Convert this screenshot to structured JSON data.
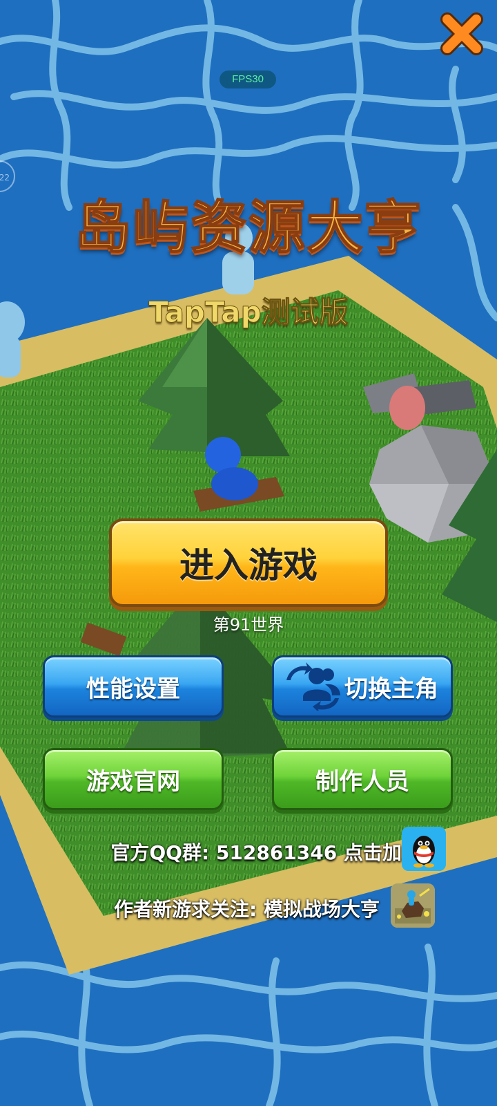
{
  "hud": {
    "fps_label": "FPS30",
    "side_dial_text": "22"
  },
  "header": {
    "title": "岛屿资源大亨",
    "subtitle": "TapTap测试版"
  },
  "main": {
    "enter_button": "进入游戏",
    "world_label": "第91世界",
    "settings_button": "性能设置",
    "switch_character_button": "切换主角",
    "official_site_button": "游戏官网",
    "credits_button": "制作人员"
  },
  "footer": {
    "qq_group_text": "官方QQ群: 512861346 点击加入",
    "new_game_text": "作者新游求关注: 模拟战场大亨"
  },
  "icons": {
    "close": "close-icon",
    "users_swap": "users-swap-icon",
    "qq": "qq-penguin-icon",
    "game_thumb": "battlefield-game-icon"
  },
  "colors": {
    "water": "#1f6fc0",
    "sand": "#d8bd63",
    "grass": "#3f8e2a",
    "enter_yellow": "#ffc628",
    "button_blue": "#2a95e8",
    "button_green": "#5cc530",
    "close_orange": "#ff7a1a"
  }
}
